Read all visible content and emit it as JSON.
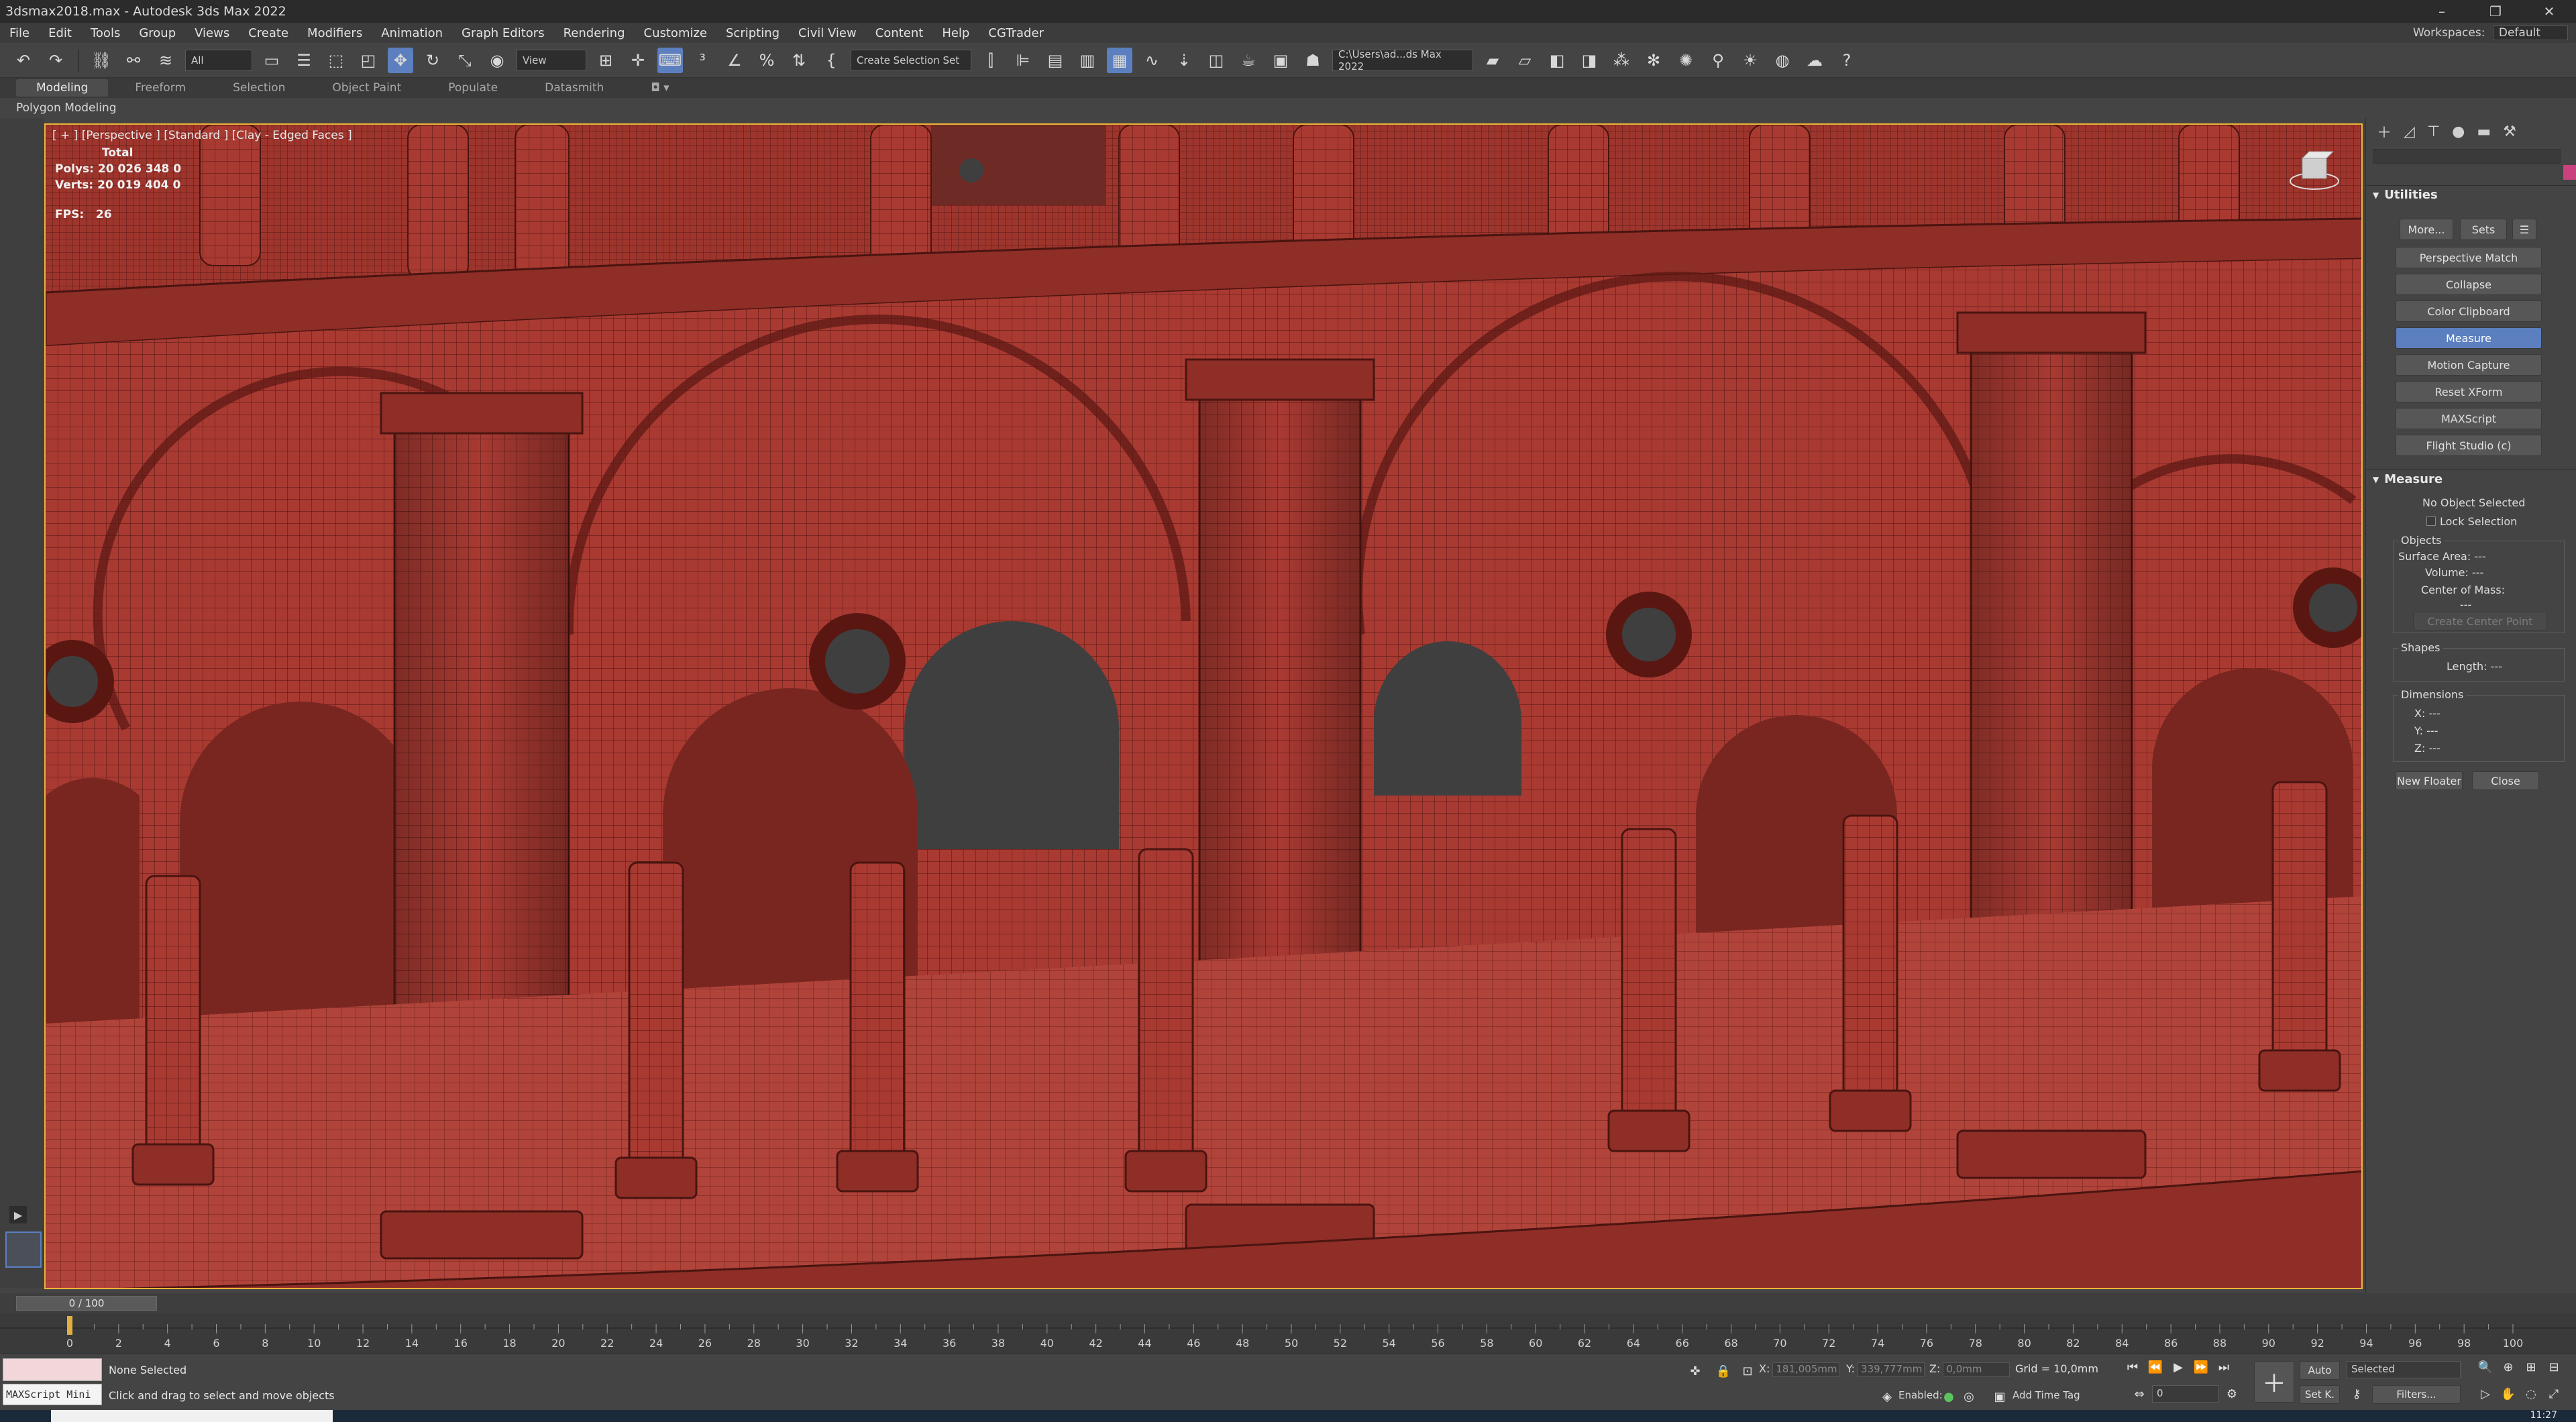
{
  "window": {
    "title": "3dsmax2018.max - Autodesk 3ds Max 2022",
    "minimize": "–",
    "maximize": "❐",
    "close": "✕"
  },
  "menu": {
    "items": [
      "File",
      "Edit",
      "Tools",
      "Group",
      "Views",
      "Create",
      "Modifiers",
      "Animation",
      "Graph Editors",
      "Rendering",
      "Customize",
      "Scripting",
      "Civil View",
      "Content",
      "Help",
      "CGTrader"
    ],
    "workspace_label": "Workspaces:",
    "workspace_value": "Default"
  },
  "toolbar": {
    "selection_filter": "All",
    "reference_coord": "View",
    "named_selection": "Create Selection Set",
    "project_path": "C:\\Users\\ad...ds Max 2022"
  },
  "ribbon": {
    "tabs": [
      "Modeling",
      "Freeform",
      "Selection",
      "Object Paint",
      "Populate",
      "Datasmith"
    ],
    "active_tab": "Modeling",
    "sub_label": "Polygon Modeling"
  },
  "viewport": {
    "label": "[ + ] [Perspective ]  [Standard ]  [Clay - Edged Faces ]",
    "stats_total_label": "Total",
    "polys_label": "Polys:",
    "polys_value": "20 026 348  0",
    "verts_label": "Verts:",
    "verts_value": "20 019 404  0",
    "fps_label": "FPS:",
    "fps_value": "26",
    "colors": {
      "mesh": "#a83a32",
      "wire": "#5a1712",
      "shadow": "#7a2620",
      "void": "#3f3f3f",
      "border": "#f0b43a"
    }
  },
  "command_panel": {
    "tab_icons": [
      "create-icon",
      "modify-icon",
      "hierarchy-icon",
      "motion-icon",
      "display-icon",
      "utilities-icon"
    ],
    "utilities": {
      "title": "Utilities",
      "more_label": "More...",
      "sets_label": "Sets",
      "buttons": [
        "Perspective Match",
        "Collapse",
        "Color Clipboard",
        "Measure",
        "Motion Capture",
        "Reset XForm",
        "MAXScript",
        "Flight Studio (c)"
      ],
      "active": "Measure"
    },
    "measure": {
      "title": "Measure",
      "selection_status": "No Object Selected",
      "lock_selection": "Lock Selection",
      "objects_label": "Objects",
      "surface_area": "Surface Area:  ---",
      "volume": "Volume:  ---",
      "center_of_mass": "Center of Mass:",
      "center_value": "---",
      "create_center_point": "Create Center Point",
      "shapes_label": "Shapes",
      "length": "Length:  ---",
      "dimensions_label": "Dimensions",
      "x": "X:  ---",
      "y": "Y:  ---",
      "z": "Z:  ---",
      "new_floater": "New Floater",
      "close": "Close"
    },
    "accent_color": "#5b7fbf",
    "swatch_color": "#c9427d"
  },
  "timeline": {
    "frame_display": "0 / 100",
    "ticks": [
      "0",
      "2",
      "4",
      "6",
      "8",
      "10",
      "12",
      "14",
      "16",
      "18",
      "20",
      "22",
      "24",
      "26",
      "28",
      "30",
      "32",
      "34",
      "36",
      "38",
      "40",
      "42",
      "44",
      "46",
      "48",
      "50",
      "52",
      "54",
      "56",
      "58",
      "60",
      "62",
      "64",
      "66",
      "68",
      "70",
      "72",
      "74",
      "76",
      "78",
      "80",
      "82",
      "84",
      "86",
      "88",
      "90",
      "92",
      "94",
      "96",
      "98",
      "100"
    ]
  },
  "status": {
    "maxscript_label": "MAXScript Mini",
    "selection": "None Selected",
    "prompt": "Click and drag to select and move objects",
    "x_label": "X:",
    "x_value": "181,005mm",
    "y_label": "Y:",
    "y_value": "339,777mm",
    "z_label": "Z:",
    "z_value": "0,0mm",
    "grid": "Grid = 10,0mm",
    "enabled": "Enabled:",
    "add_time_tag": "Add Time Tag",
    "auto_key": "Auto",
    "key_filter": "Selected",
    "set_key": "Set K.",
    "filters": "Filters...",
    "frame_field": "0"
  },
  "taskbar": {
    "clock": "11:27"
  }
}
